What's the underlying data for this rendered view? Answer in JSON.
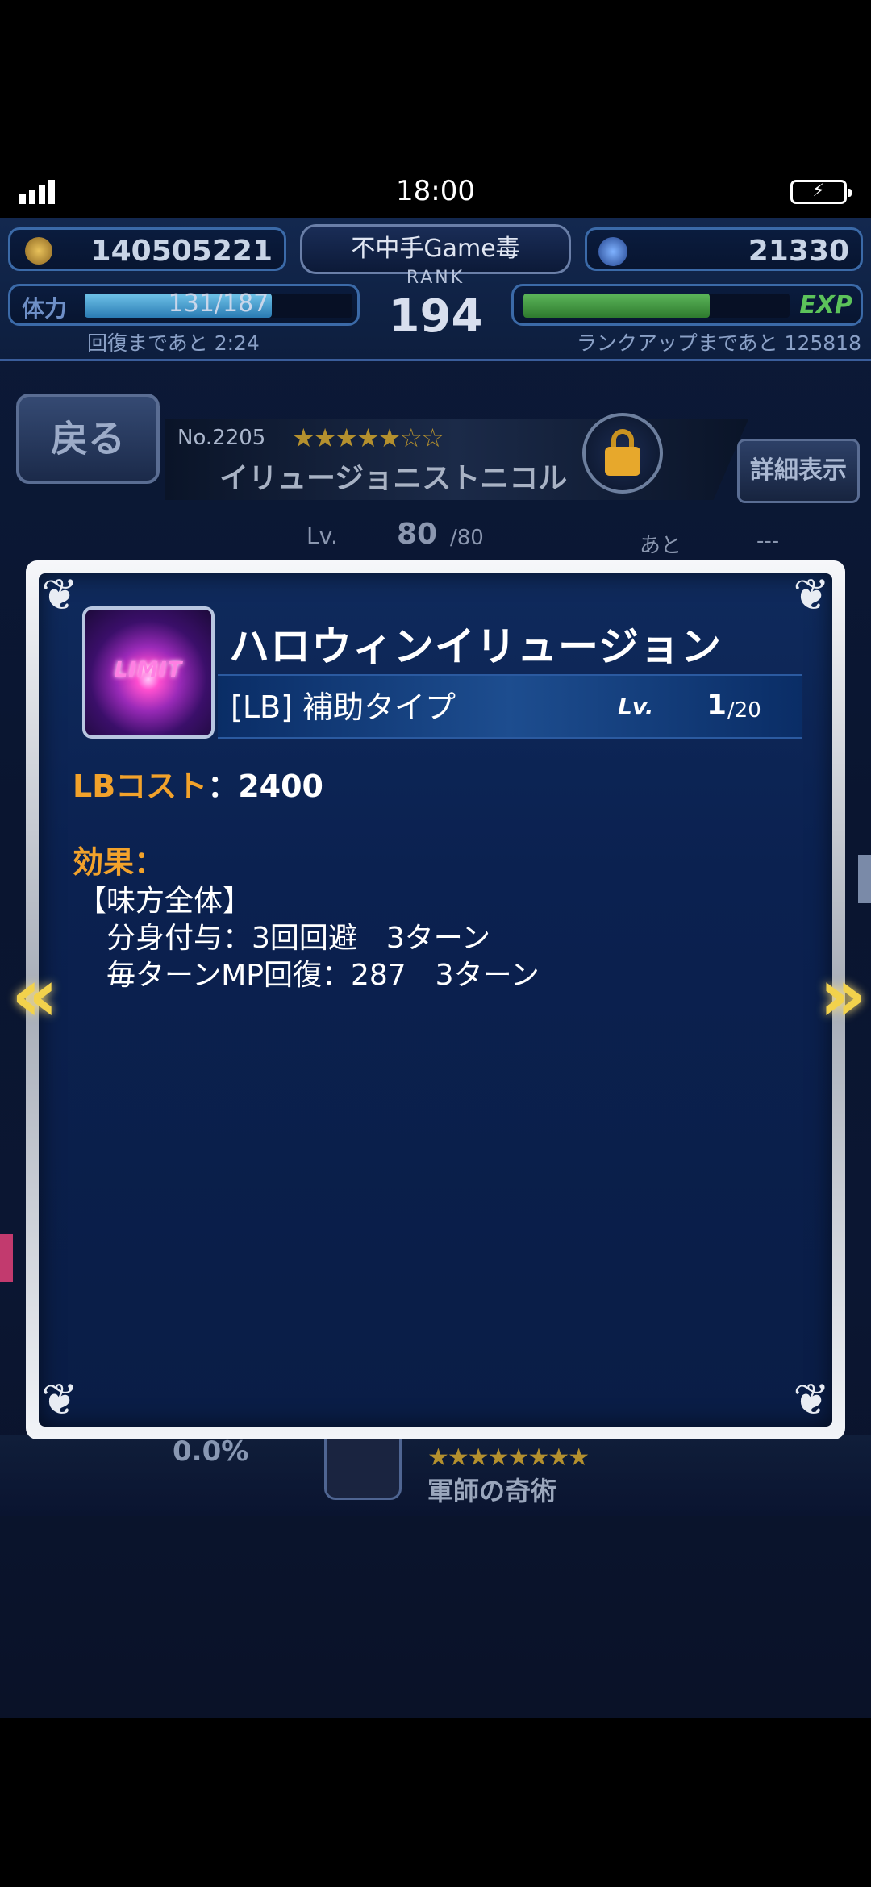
{
  "status_bar": {
    "time": "18:00"
  },
  "hud": {
    "gil": "140505221",
    "player_name": "不中手Game毒",
    "lapis": "21330",
    "rank_label": "RANK",
    "rank": "194",
    "stamina_label": "体力",
    "stamina": "131/187",
    "stamina_recover": "回復まであと 2:24",
    "exp_label": "EXP",
    "rank_up": "ランクアップまであと 125818"
  },
  "unit": {
    "back_label": "戻る",
    "number": "No.2205",
    "stars": "★★★★★☆☆",
    "name": "イリュージョニストニコル",
    "detail_label": "詳細表示",
    "lv_label": "Lv.",
    "lv": "80",
    "lv_max": "/80",
    "ato": "あと",
    "ato_value": "---"
  },
  "behind": {
    "percent": "0.0%",
    "stars": "★★★★★★★★",
    "ability_name": "軍師の奇術"
  },
  "modal": {
    "icon_label": "LIMIT",
    "title": "ハロウィンイリュージョン",
    "type": "[LB] 補助タイプ",
    "lv_label": "Lv.",
    "lv": "1",
    "lv_max": "/20",
    "cost_label": "LBコスト",
    "cost_sep": "：",
    "cost_value": "2400",
    "effect_label": "効果：",
    "effect_lines": [
      "【味方全体】",
      "分身付与：3回回避　3ターン",
      "毎ターンMP回復：287　3ターン"
    ]
  },
  "arrows": {
    "left": "«",
    "right": "»"
  }
}
